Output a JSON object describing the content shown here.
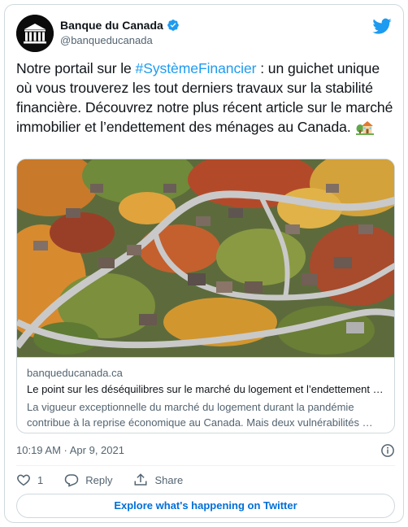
{
  "colors": {
    "accent": "#1d9bf0",
    "text_primary": "#0f1419",
    "text_secondary": "#536471",
    "border": "#cfd9de",
    "link_button": "#006fd6"
  },
  "author": {
    "display_name": "Banque du Canada",
    "handle": "@banqueducanada",
    "verified_icon": "verified-badge-icon",
    "avatar_icon": "bank-building-icon"
  },
  "tweet": {
    "text_before": "Notre portail sur le ",
    "hashtag": "#SystèmeFinancier",
    "text_after": " : un guichet unique où vous trouverez les tout derniers travaux sur la stabilité financière. Découvrez notre plus récent article sur le marché immobilier et l’endettement des ménages au Canada. ",
    "emoji_icon": "house-with-garden-icon"
  },
  "link_card": {
    "image_icon": "aerial-suburb-photo",
    "domain": "banqueducanada.ca",
    "title": "Le point sur les déséquilibres sur le marché du logement et l’endettement des ménages",
    "description": "La vigueur exceptionnelle du marché du logement durant la pandémie contribue à la reprise économique au Canada. Mais deux vulnérabilités …"
  },
  "meta": {
    "timestamp": "10:19 AM · Apr 9, 2021",
    "info_icon": "info-icon"
  },
  "actions": {
    "like_count": "1",
    "reply_label": "Reply",
    "share_label": "Share"
  },
  "explore_label": "Explore what's happening on Twitter"
}
